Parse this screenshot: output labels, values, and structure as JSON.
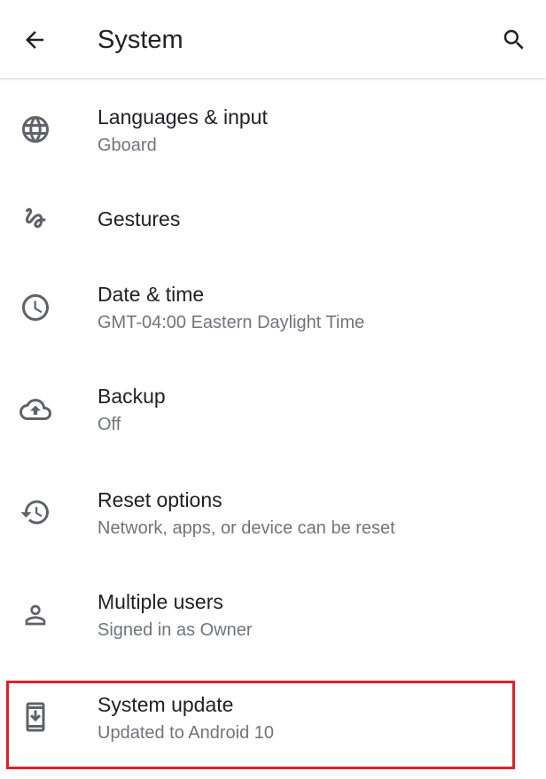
{
  "header": {
    "title": "System",
    "back_icon": "arrow-back-icon",
    "search_icon": "search-icon"
  },
  "items": [
    {
      "label": "Languages & input",
      "sub": "Gboard",
      "icon": "globe-icon"
    },
    {
      "label": "Gestures",
      "sub": "",
      "icon": "gestures-icon"
    },
    {
      "label": "Date & time",
      "sub": "GMT-04:00 Eastern Daylight Time",
      "icon": "clock-icon"
    },
    {
      "label": "Backup",
      "sub": "Off",
      "icon": "cloud-upload-icon"
    },
    {
      "label": "Reset options",
      "sub": "Network, apps, or device can be reset",
      "icon": "restore-icon"
    },
    {
      "label": "Multiple users",
      "sub": "Signed in as Owner",
      "icon": "person-icon"
    },
    {
      "label": "System update",
      "sub": "Updated to Android 10",
      "icon": "system-update-icon"
    }
  ],
  "colors": {
    "primary_text": "#202124",
    "secondary_text": "#70757a",
    "icon": "#5f6368",
    "highlight_border": "#e0202b"
  }
}
